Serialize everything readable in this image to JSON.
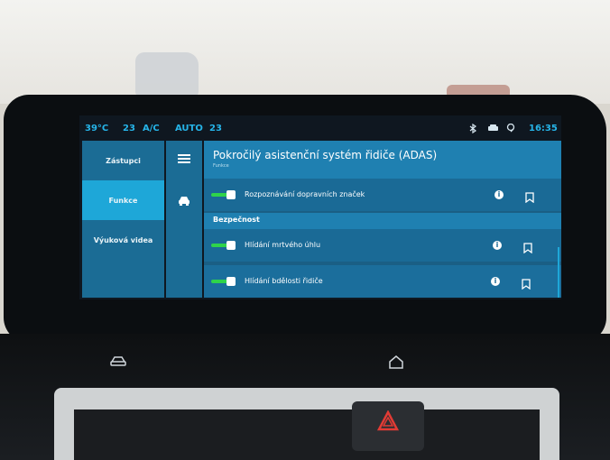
{
  "colors": {
    "accent_blue": "#1ea7d8",
    "panel_blue": "#1b6c95",
    "row_blue": "#1a6a96",
    "toggle_green": "#2fd34a"
  },
  "status_bar": {
    "temp_left": "39°C",
    "fan_left": "23",
    "ac": "A/C",
    "auto": "AUTO",
    "fan_right": "23",
    "clock": "16:35",
    "icons": [
      "bluetooth-icon",
      "car-connect-icon",
      "location-icon"
    ]
  },
  "sidebar": {
    "items": [
      {
        "label": "Zástupci",
        "active": false
      },
      {
        "label": "Funkce",
        "active": true
      },
      {
        "label": "Výuková videa",
        "active": false
      }
    ]
  },
  "rail": {
    "icons": [
      "menu-icon",
      "car-icon"
    ]
  },
  "main": {
    "title": "Pokročilý asistenční systém řidiče (ADAS)",
    "subtitle": "Funkce",
    "rows_top": [
      {
        "label": "Rozpoznávání dopravních značek",
        "enabled": true
      }
    ],
    "section_label": "Bezpečnost",
    "rows_safety": [
      {
        "label": "Hlídání mrtvého úhlu",
        "enabled": true
      },
      {
        "label": "Hlídání bdělosti řidiče",
        "enabled": true
      }
    ]
  },
  "hardware": {
    "buttons": [
      "car-button-icon",
      "home-button-icon",
      "hazard-icon"
    ]
  }
}
